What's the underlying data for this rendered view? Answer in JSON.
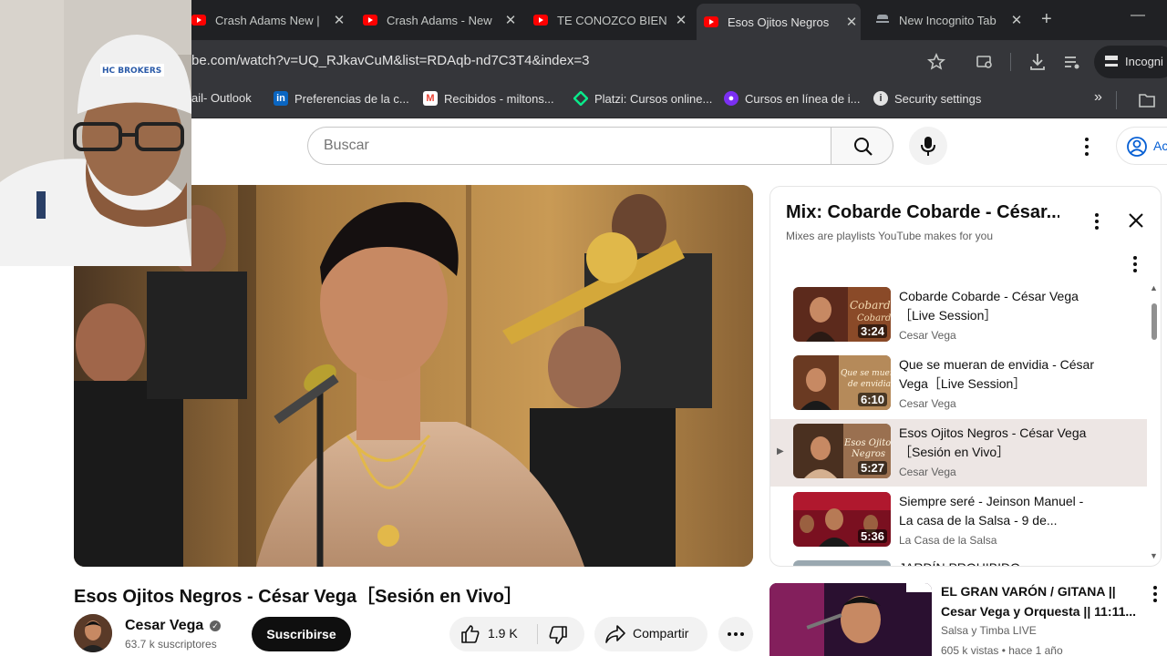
{
  "browser": {
    "tabs": [
      {
        "title": "Crash Adams New |",
        "close": "✕"
      },
      {
        "title": "Crash Adams - New",
        "close": "✕"
      },
      {
        "title": "TE CONOZCO BIEN",
        "close": "✕"
      },
      {
        "title": "Esos Ojitos Negros",
        "close": "✕",
        "active": true
      },
      {
        "title": "New Incognito Tab",
        "close": "✕"
      }
    ],
    "new_tab": "+",
    "minimize": "—",
    "url": "be.com/watch?v=UQ_RJkavCuM&list=RDAqb-nd7C3T4&index=3",
    "incognito_label": "Incogni",
    "bookmarks": [
      {
        "label": "ail- Outlook",
        "icon": "outlook-icon",
        "color": "#0a64c8"
      },
      {
        "label": "Preferencias de la c...",
        "icon": "linkedin-icon",
        "color": "#0a66c2"
      },
      {
        "label": "Recibidos - miltons...",
        "icon": "gmail-icon",
        "color": "#ea4335"
      },
      {
        "label": "Platzi: Cursos online...",
        "icon": "platzi-icon",
        "color": "#0ae98a"
      },
      {
        "label": "Cursos en línea de i...",
        "icon": "course-icon",
        "color": "#7b2ff2"
      },
      {
        "label": "Security settings",
        "icon": "info-icon",
        "color": "#ffffff"
      }
    ],
    "bookmarks_more": "»"
  },
  "youtube": {
    "search_placeholder": "Buscar",
    "signin_label": "Ac"
  },
  "video": {
    "title": "Esos Ojitos Negros - César Vega［Sesión en Vivo］",
    "channel": "Cesar Vega",
    "verified_mark": "✓",
    "subscribers": "63.7 k suscriptores",
    "subscribe_label": "Suscribirse",
    "likes": "1.9 K",
    "share_label": "Compartir"
  },
  "playlist": {
    "title": "Mix: Cobarde Cobarde - César...",
    "subtitle": "Mixes are playlists YouTube makes for you",
    "now_playing_marker": "▶",
    "scroll_up": "▲",
    "scroll_down": "▼",
    "items": [
      {
        "title": "Cobarde Cobarde - César Vega［Live Session］",
        "channel": "Cesar Vega",
        "duration": "3:24",
        "current": false,
        "thumb_text": "Cobarde Cobarde"
      },
      {
        "title": "Que se mueran de envidia - César Vega［Live Session］",
        "channel": "Cesar Vega",
        "duration": "6:10",
        "current": false,
        "thumb_text": "Que se mueran de envidia"
      },
      {
        "title": "Esos Ojitos Negros - César Vega［Sesión en Vivo］",
        "channel": "Cesar Vega",
        "duration": "5:27",
        "current": true,
        "thumb_text": "Esos Ojitos Negros"
      },
      {
        "title": "Siempre seré - Jeinson Manuel - La casa de la Salsa - 9 de...",
        "channel": "La Casa de la Salsa",
        "duration": "5:36",
        "current": false,
        "thumb_text": ""
      }
    ],
    "partial_next": "JARDÍN PROHIBIDO"
  },
  "recommendation": {
    "title": "EL GRAN VARÓN / GITANA || Cesar Vega y Orquesta || 11:11...",
    "channel": "Salsa y Timba LIVE",
    "meta": "605 k vistas • hace 1 año"
  },
  "colors": {
    "chrome_dark": "#202124",
    "chrome_mid": "#35363a",
    "youtube_red": "#ff0000",
    "link_blue": "#065fd4",
    "current_row": "#ede6e4"
  }
}
